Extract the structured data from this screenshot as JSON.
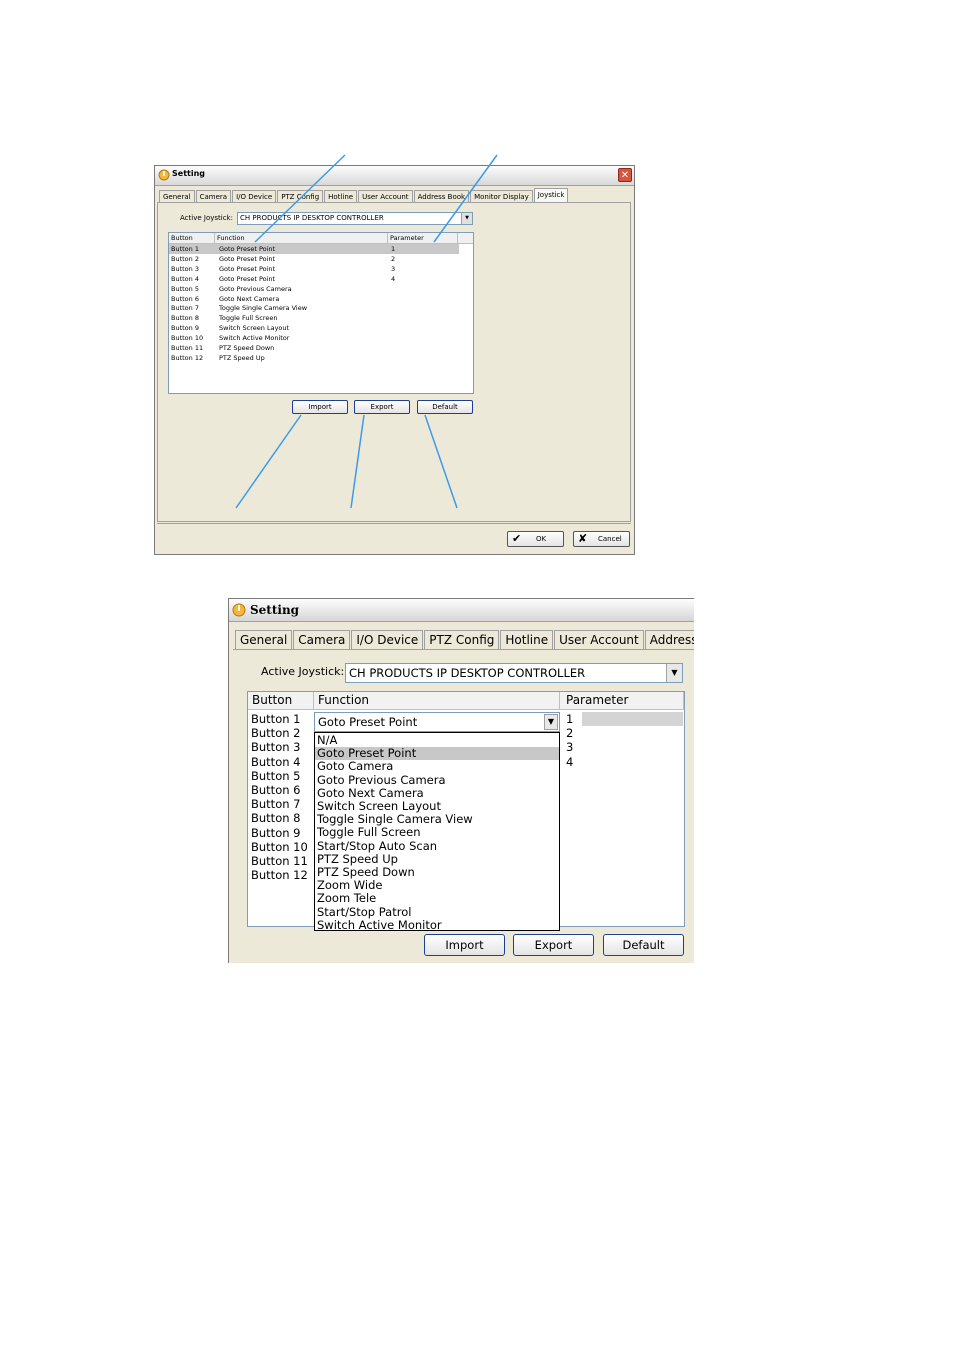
{
  "window1": {
    "title": "Setting",
    "tabs": [
      "General",
      "Camera",
      "I/O Device",
      "PTZ Config",
      "Hotline",
      "User Account",
      "Address Book",
      "Monitor Display",
      "Joystick"
    ],
    "active_tab": "Joystick",
    "active_joystick_label": "Active Joystick:",
    "active_joystick_value": "CH PRODUCTS IP DESKTOP CONTROLLER",
    "columns": [
      "Button",
      "Function",
      "Parameter"
    ],
    "rows": [
      {
        "button": "Button 1",
        "function": "Goto Preset Point",
        "parameter": "1"
      },
      {
        "button": "Button 2",
        "function": "Goto Preset Point",
        "parameter": "2"
      },
      {
        "button": "Button 3",
        "function": "Goto Preset Point",
        "parameter": "3"
      },
      {
        "button": "Button 4",
        "function": "Goto Preset Point",
        "parameter": "4"
      },
      {
        "button": "Button 5",
        "function": "Goto Previous Camera",
        "parameter": ""
      },
      {
        "button": "Button 6",
        "function": "Goto Next Camera",
        "parameter": ""
      },
      {
        "button": "Button 7",
        "function": "Toggle Single Camera View",
        "parameter": ""
      },
      {
        "button": "Button 8",
        "function": "Toggle Full Screen",
        "parameter": ""
      },
      {
        "button": "Button 9",
        "function": "Switch Screen Layout",
        "parameter": ""
      },
      {
        "button": "Button 10",
        "function": "Switch Active Monitor",
        "parameter": ""
      },
      {
        "button": "Button 11",
        "function": "PTZ Speed Down",
        "parameter": ""
      },
      {
        "button": "Button 12",
        "function": "PTZ Speed Up",
        "parameter": ""
      }
    ],
    "buttons": {
      "import": "Import",
      "export": "Export",
      "default": "Default",
      "ok": "OK",
      "cancel": "Cancel"
    }
  },
  "window2": {
    "title": "Setting",
    "tabs": [
      "General",
      "Camera",
      "I/O Device",
      "PTZ Config",
      "Hotline",
      "User Account",
      "Address Book"
    ],
    "active_joystick_label": "Active Joystick:",
    "active_joystick_value": "CH PRODUCTS IP DESKTOP CONTROLLER",
    "columns": [
      "Button",
      "Function",
      "Parameter"
    ],
    "buttons_col": [
      "Button 1",
      "Button 2",
      "Button 3",
      "Button 4",
      "Button 5",
      "Button 6",
      "Button 7",
      "Button 8",
      "Button 9",
      "Button 10",
      "Button 11",
      "Button 12"
    ],
    "parameters": [
      "1",
      "2",
      "3",
      "4"
    ],
    "combo_value": "Goto Preset Point",
    "dropdown_options": [
      "N/A",
      "Goto Preset Point",
      "Goto Camera",
      "Goto Previous Camera",
      "Goto Next Camera",
      "Switch Screen Layout",
      "Toggle Single Camera View",
      "Toggle Full Screen",
      "Start/Stop Auto Scan",
      "PTZ Speed Up",
      "PTZ Speed Down",
      "Zoom Wide",
      "Zoom Tele",
      "Start/Stop Patrol",
      "Switch Active Monitor"
    ],
    "selected_option": "Goto Preset Point",
    "buttons": {
      "import": "Import",
      "export": "Export",
      "default": "Default"
    }
  },
  "colors": {
    "callout": "#3d9be9",
    "selection": "#c8c8c8",
    "window_bg": "#ece9d8"
  }
}
